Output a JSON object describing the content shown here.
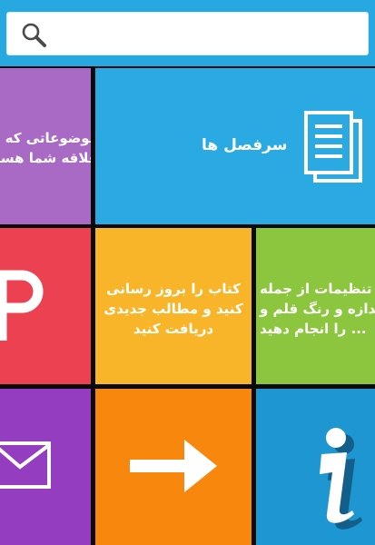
{
  "search": {
    "placeholder": "",
    "icon": "search-icon"
  },
  "tiles": {
    "topics": {
      "line1": "موضوعاتی که",
      "line2": "علاقه شما هستند",
      "color": "#a96ac6"
    },
    "chapters": {
      "label": "سرفصل ها",
      "icon": "document-icon",
      "color": "#2aa9e2"
    },
    "parking": {
      "icon": "p-letter-icon",
      "color": "#ec4150"
    },
    "update": {
      "line1": "کتاب را بروز رسانی",
      "line2": "کنید و مطالب جدیدی",
      "line3": "دریافت کنید",
      "color": "#f8b52a"
    },
    "settings": {
      "line1": "تنظیمات از جمله",
      "line2": "اندازه و رنگ قلم و",
      "line3": "... را انجام دهید",
      "color": "#8cc63e"
    },
    "contact": {
      "icon": "envelope-icon",
      "color": "#943dc1"
    },
    "next": {
      "icon": "arrow-right-icon",
      "color": "#f8880d"
    },
    "info": {
      "icon": "info-icon",
      "color": "#1d96d2"
    }
  },
  "colors": {
    "topbar": "#28a8e0",
    "background": "#0b0b0b"
  }
}
